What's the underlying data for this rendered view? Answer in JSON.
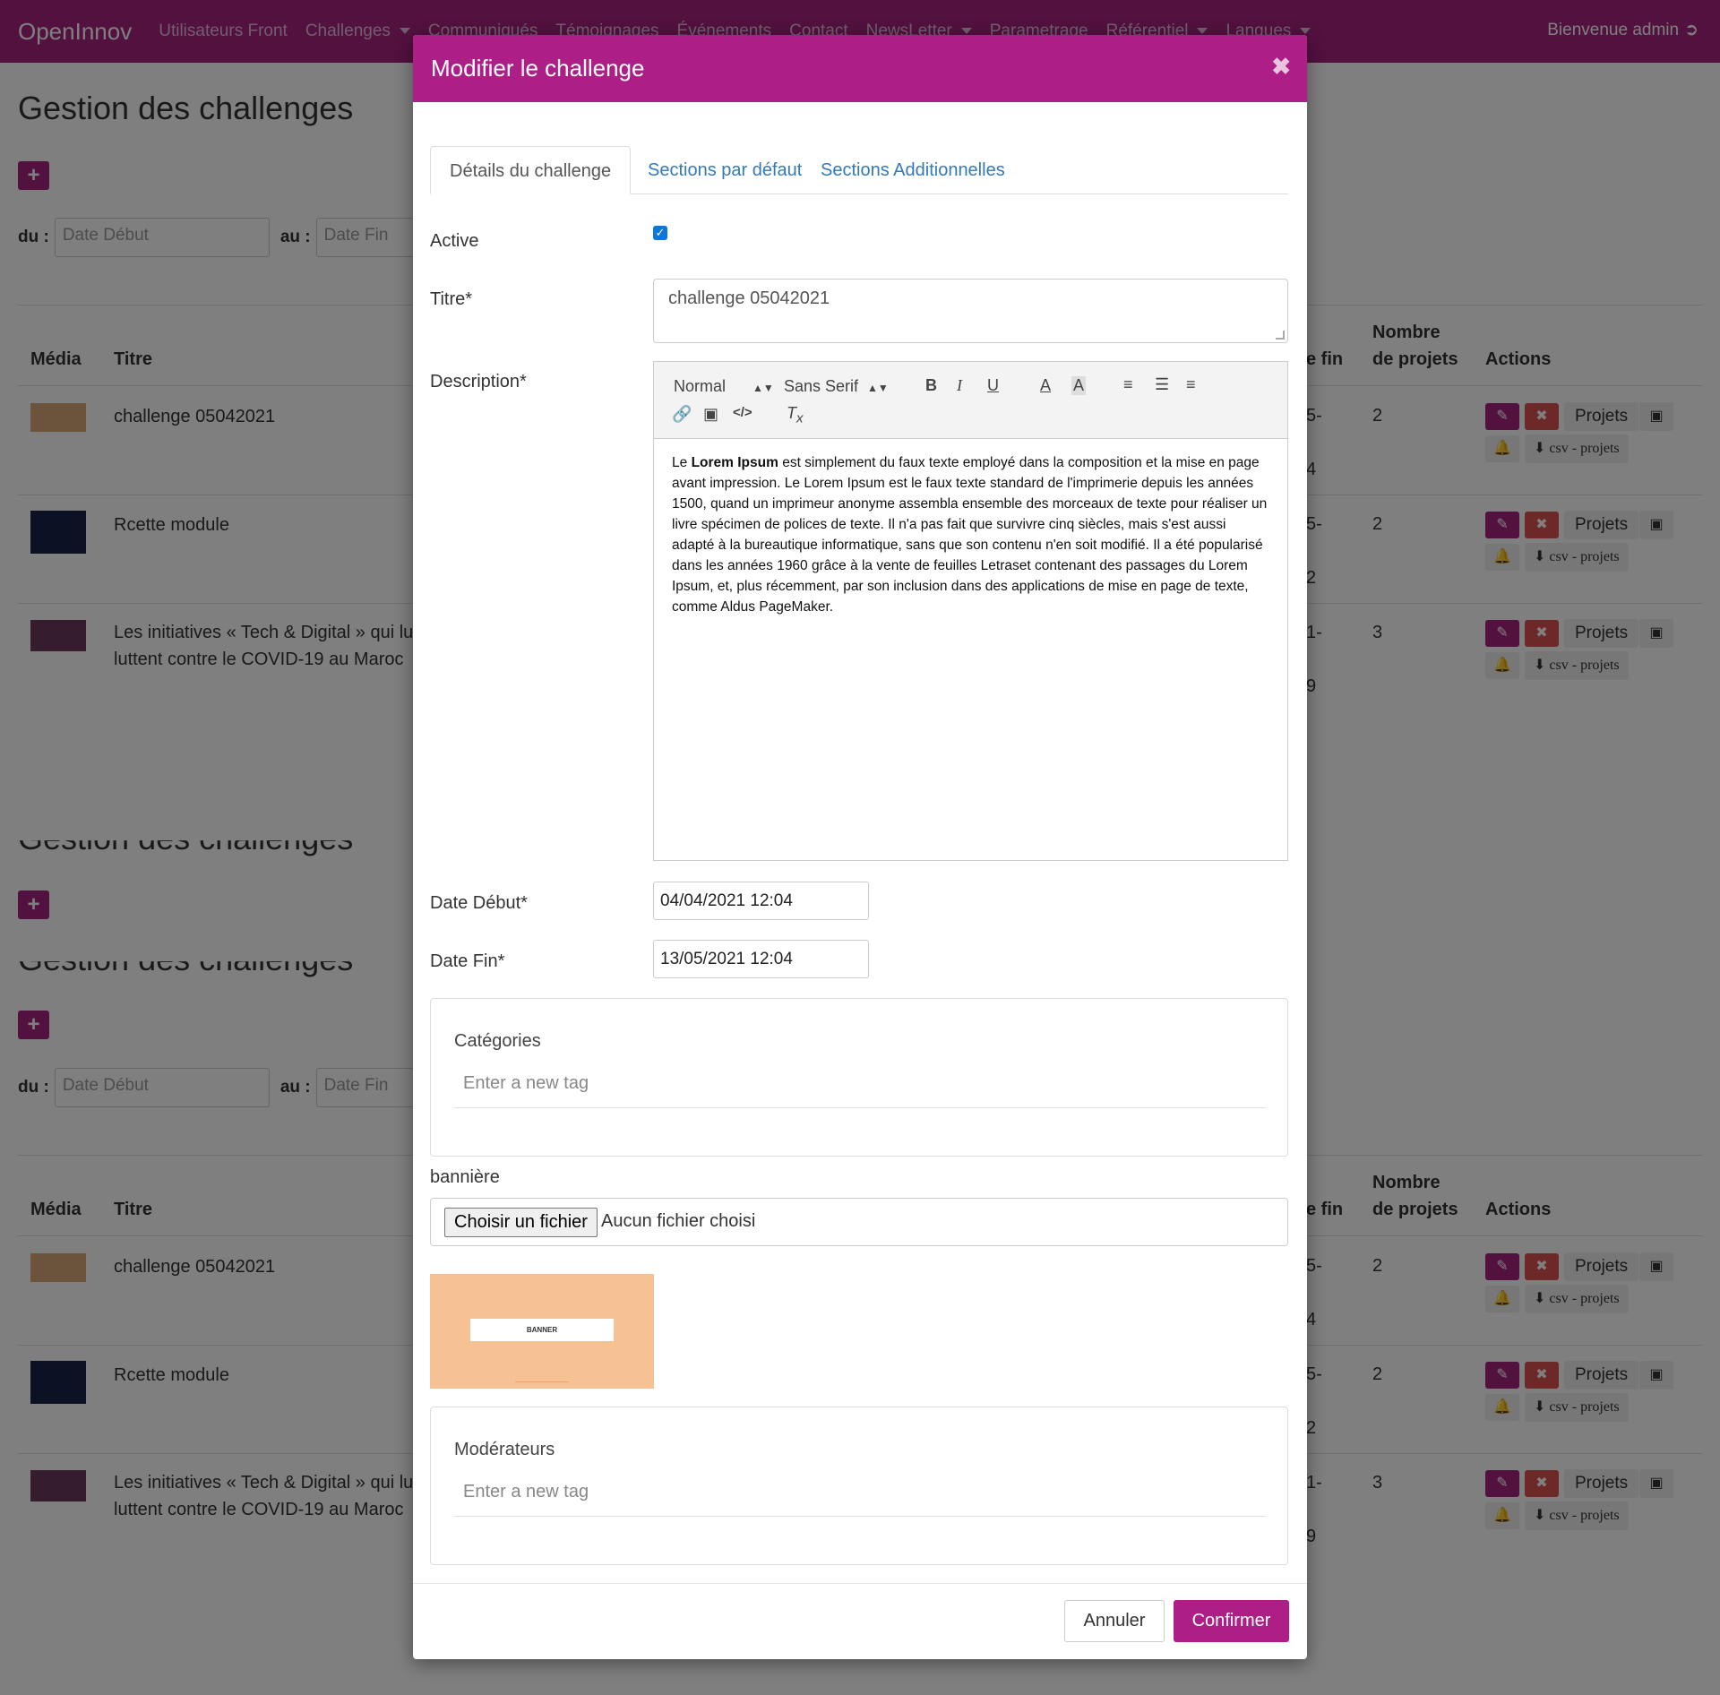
{
  "navbar": {
    "brand": "OpenInnov",
    "links": [
      "Utilisateurs Front",
      "Challenges",
      "Communiqués",
      "Témoignages",
      "Événements",
      "Contact",
      "NewsLetter",
      "Parametrage",
      "Référentiel",
      "Langues"
    ],
    "welcome": "Bienvenue admin"
  },
  "background": {
    "page_title": "Gestion des challenges",
    "add_icon": "plus-icon",
    "filter": {
      "du_label": "du :",
      "au_label": "au :",
      "date_debut_placeholder": "Date Début",
      "date_fin_placeholder": "Date Fin"
    },
    "table": {
      "headers": {
        "media": "Média",
        "titre": "Titre",
        "date_fin": "e fin",
        "nombre_line1": "Nombre",
        "nombre_line2": "de projets",
        "actions": "Actions"
      },
      "rows": [
        {
          "title": "challenge 05042021",
          "title2": "",
          "frag1": "5-",
          "frag2": "4",
          "count": "2"
        },
        {
          "title": "Rcette module",
          "title2": "",
          "frag1": "5-",
          "frag2": "2",
          "count": "2"
        },
        {
          "title": "Les initiatives « Tech & Digital » qui lu",
          "title2": "luttent contre le COVID-19 au Maroc",
          "frag1": "1-",
          "frag2": "9",
          "count": "3"
        }
      ],
      "actions": {
        "projets": "Projets",
        "csv": "csv - projets"
      }
    }
  },
  "modal": {
    "title": "Modifier le challenge",
    "close_icon": "close-icon",
    "tabs": [
      "Détails du challenge",
      "Sections par défaut",
      "Sections Additionnelles"
    ],
    "fields": {
      "active_label": "Active",
      "active_checked": true,
      "titre_label": "Titre*",
      "titre_value": "challenge 05042021",
      "description_label": "Description*",
      "date_debut_label": "Date Début*",
      "date_debut_value": "04/04/2021 12:04",
      "date_fin_label": "Date Fin*",
      "date_fin_value": "13/05/2021 12:04"
    },
    "editor": {
      "format_select": "Normal",
      "font_select": "Sans Serif",
      "text_bold_lead": "Lorem Ipsum",
      "text_prefix": "Le",
      "text_body": "est simplement du faux texte employé dans la composition et la mise en page avant impression. Le Lorem Ipsum est le faux texte standard de l'imprimerie depuis les années 1500, quand un imprimeur anonyme assembla ensemble des morceaux de texte pour réaliser un livre spécimen de polices de texte. Il n'a pas fait que survivre cinq siècles, mais s'est aussi adapté à la bureautique informatique, sans que son contenu n'en soit modifié. Il a été popularisé dans les années 1960 grâce à la vente de feuilles Letraset contenant des passages du Lorem Ipsum, et, plus récemment, par son inclusion dans des applications de mise en page de texte, comme Aldus PageMaker."
    },
    "categories": {
      "title": "Catégories",
      "placeholder": "Enter a new tag"
    },
    "banner": {
      "label": "bannière",
      "file_button": "Choisir un fichier",
      "file_status": "Aucun fichier choisi",
      "preview_text": "BANNER"
    },
    "moderateurs": {
      "title": "Modérateurs",
      "placeholder": "Enter a new tag"
    },
    "footer": {
      "cancel": "Annuler",
      "confirm": "Confirmer"
    }
  },
  "colors": {
    "brand": "#a4237f",
    "modal_header": "#ad1e87",
    "link": "#337ab7",
    "danger": "#d9534f"
  }
}
